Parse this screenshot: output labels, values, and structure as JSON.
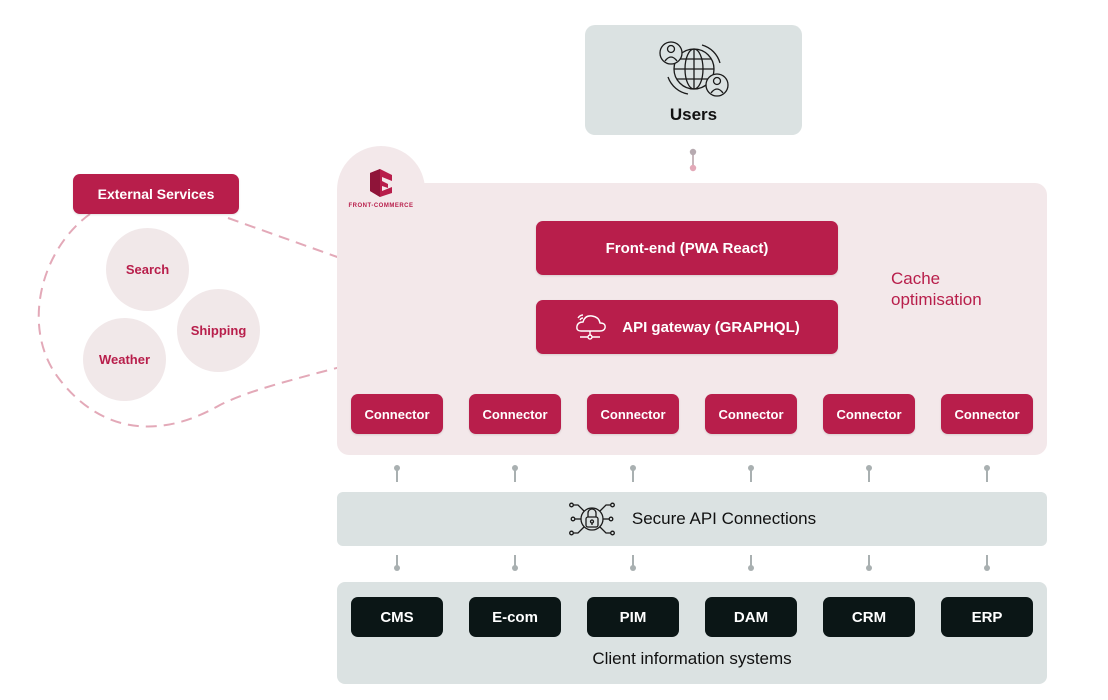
{
  "users": {
    "label": "Users",
    "icon": "globe-users-icon"
  },
  "brand": {
    "name": "FRONT-COMMERCE",
    "logo_color": "#b81e4b"
  },
  "platform": {
    "frontend_label": "Front-end (PWA React)",
    "api_gateway_label": "API gateway (GRAPHQL)",
    "api_gateway_icon": "cloud-network-icon",
    "cache_label_line1": "Cache",
    "cache_label_line2": "optimisation",
    "connectors": [
      "Connector",
      "Connector",
      "Connector",
      "Connector",
      "Connector",
      "Connector"
    ]
  },
  "external_services": {
    "title": "External Services",
    "services": [
      "Search",
      "Shipping",
      "Weather"
    ]
  },
  "secure_api": {
    "label": "Secure API Connections",
    "icon": "lock-network-icon"
  },
  "client_systems": {
    "label": "Client information systems",
    "systems": [
      "CMS",
      "E-com",
      "PIM",
      "DAM",
      "CRM",
      "ERP"
    ]
  },
  "colors": {
    "accent": "#b81e4b",
    "panel_pink": "#f3e8ea",
    "panel_grey": "#dbe2e2",
    "system_dark": "#0b1616",
    "connector_line_pink": "#e3a9b8",
    "connector_line_grey": "#a9b0b1"
  }
}
